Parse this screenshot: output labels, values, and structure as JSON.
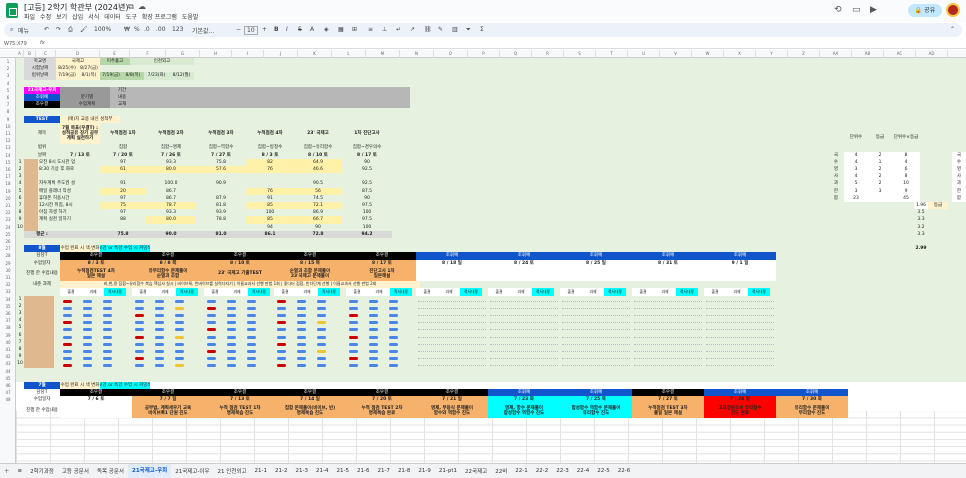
{
  "app": {
    "title": "[고등] 2학기 학관부 (2024년)",
    "share_label": "공유",
    "cell_ref": "W75:X79",
    "menu": [
      "파일",
      "수정",
      "보기",
      "삽입",
      "서식",
      "데이터",
      "도구",
      "확장 프로그램",
      "도움말"
    ],
    "toolbar": {
      "search": "메뉴",
      "zoom": "100%",
      "percent": "%",
      "dec": ".0",
      "dec2": ".00",
      "fmt": "123",
      "font": "기본값...",
      "size": "10"
    }
  },
  "columns": [
    "A",
    "B",
    "C",
    "D",
    "E",
    "F",
    "G",
    "H",
    "I",
    "J",
    "K",
    "L",
    "M",
    "N",
    "O",
    "P",
    "Q",
    "R",
    "S",
    "T",
    "U",
    "V",
    "W",
    "X",
    "Y",
    "Z",
    "AA",
    "AB",
    "AC",
    "AD",
    "AE",
    "AF",
    "AG",
    "AH",
    "AI",
    "AJ",
    "AK",
    "AL",
    "AM",
    "AN",
    "AO",
    "AP",
    "AQ"
  ],
  "rows": [
    "1",
    "2",
    "3",
    "4",
    "5",
    "6",
    "7",
    "8",
    "9",
    "10",
    "11",
    "12",
    "13",
    "14",
    "15",
    "16",
    "17",
    "18",
    "19",
    "20",
    "21",
    "22",
    "23",
    "24",
    "25",
    "26",
    "27",
    "28",
    "29",
    "30",
    "31",
    "32",
    "33",
    "34",
    "35",
    "36",
    "37",
    "38",
    "39",
    "40",
    "41",
    "42",
    "43",
    "44",
    "45",
    "46",
    "47",
    "48"
  ],
  "top": {
    "school": "학교명",
    "exam_date": "시험날짜",
    "range_date": "범위날짜",
    "s1": "국제고",
    "s2": "미추홀고",
    "s3": "인천외고",
    "d1": "8/25(수)",
    "d2": "8/27(금)",
    "r1": "7/19(금)",
    "r2": "8/1(목)",
    "r3": "7/19(금)",
    "r4": "8/8(목)",
    "r5": "7/23(화)",
    "r6": "8/12(월)"
  },
  "info": {
    "class": "21국제고-우희",
    "teacher": "조휘예",
    "label_assistant": "조우결",
    "l1": "분기별",
    "l2": "수업계획",
    "k1": "기간",
    "k2": "내용",
    "k3": "교재"
  },
  "test": {
    "header": "TEST",
    "banner": "(매)지 교용 내신 성적부",
    "subject": "제목",
    "range": "범위",
    "date": "날짜",
    "avg": "평균 :",
    "tests": [
      {
        "title": "7월 목표(우결T) : 성적공유 장기 공부 계획 실천하기",
        "range": "",
        "date": "7 / 13 토"
      },
      {
        "title": "누적점검 1차",
        "range": "집합",
        "date": "7 / 20 토"
      },
      {
        "title": "누적점검 2차",
        "range": "집합~명제",
        "date": "7 / 26 토"
      },
      {
        "title": "누적점검 3차",
        "range": "집합~역함수",
        "date": "7 / 27 토"
      },
      {
        "title": "누적점검 4차",
        "range": "집합~방정수",
        "date": "8 / 3 토"
      },
      {
        "title": "23' 국제고",
        "range": "집합~유리함수",
        "date": "8 / 10 토"
      },
      {
        "title": "1차 진단고사",
        "range": "집합~경우의수",
        "date": "8 / 17 토"
      }
    ],
    "students": [
      {
        "n": "1",
        "name": "오전 8시 도시관 업",
        "v": [
          "97",
          "93.3",
          "75.8",
          "82",
          "64.9",
          "90"
        ],
        "hl": [
          0,
          0,
          0,
          1,
          1,
          0
        ]
      },
      {
        "n": "2",
        "name": "8:30 기상 후 화로",
        "v": [
          "61",
          "80.0",
          "57.6",
          "76",
          "46.6",
          "92.5"
        ],
        "hl": [
          1,
          1,
          1,
          1,
          1,
          0
        ]
      },
      {
        "n": "3",
        "name": "",
        "v": [
          "",
          "",
          "",
          "",
          "",
          ""
        ],
        "hl": [
          0,
          0,
          0,
          0,
          0,
          0
        ]
      },
      {
        "n": "4",
        "name": "자투계획 주도권 설",
        "v": [
          "91",
          "100.0",
          "90.9",
          "",
          "90.5",
          "92.5"
        ],
        "hl": [
          0,
          0,
          0,
          0,
          0,
          0
        ]
      },
      {
        "n": "5",
        "name": "매일 플래너 작성",
        "v": [
          "20",
          "86.7",
          "",
          "76",
          "56",
          "87.5"
        ],
        "hl": [
          1,
          0,
          0,
          1,
          1,
          0
        ]
      },
      {
        "n": "6",
        "name": "휴대폰 허용시간",
        "v": [
          "97",
          "86.7",
          "87.9",
          "91",
          "74.5",
          "90"
        ],
        "hl": [
          0,
          0,
          0,
          0,
          0,
          0
        ]
      },
      {
        "n": "7",
        "name": "12시전 취침, 8시",
        "v": [
          "75",
          "78.7",
          "81.8",
          "85",
          "72.1",
          "97.5"
        ],
        "hl": [
          1,
          1,
          0,
          1,
          1,
          0
        ]
      },
      {
        "n": "8",
        "name": "아침 자생 하기",
        "v": [
          "97",
          "93.3",
          "93.9",
          "100",
          "86.9",
          "100"
        ],
        "hl": [
          0,
          0,
          0,
          0,
          0,
          0
        ]
      },
      {
        "n": "9",
        "name": "계획 실천 일하기",
        "v": [
          "88",
          "80.0",
          "78.8",
          "85",
          "66.7",
          "97.5"
        ],
        "hl": [
          0,
          1,
          0,
          1,
          1,
          0
        ]
      },
      {
        "n": "10",
        "name": "",
        "v": [
          "",
          "",
          "",
          "94",
          "90",
          "100"
        ],
        "hl": [
          0,
          0,
          0,
          0,
          0,
          0
        ]
      }
    ],
    "averages": [
      "75.8",
      "90.0",
      "81.0",
      "86.1",
      "72.8",
      "94.2"
    ]
  },
  "rank": {
    "h1": "단위수",
    "h2": "등급",
    "h3": "단위수×등급",
    "rows": [
      [
        "국",
        "4",
        "2",
        "8"
      ],
      [
        "수",
        "4",
        "1",
        "4"
      ],
      [
        "영",
        "3",
        "2",
        "6"
      ],
      [
        "사",
        "4",
        "2",
        "8"
      ],
      [
        "과",
        "5",
        "2",
        "10"
      ],
      [
        "한",
        "3",
        "3",
        "9"
      ],
      [
        "합",
        "23",
        "",
        "45"
      ]
    ],
    "total": "1.96",
    "grade_label": "등급",
    "tail": [
      "3.5",
      "3.3",
      "3.2",
      "3.3"
    ],
    "final": "2.99",
    "right_col": [
      "국",
      "수",
      "영",
      "사",
      "과",
      "한",
      "합"
    ]
  },
  "aug": {
    "month": "8월",
    "banner1": "수업 완료 시 색 변화",
    "banner2": "보강 or 특강 수업 시 커밍색",
    "labels": {
      "teacher": "담당T",
      "date": "수업일자",
      "progress": "진행 한 수업내용",
      "homework": "내준 과제"
    },
    "weeks": [
      {
        "t": "조우결",
        "d": "8 / 3 토",
        "p": "누적점검TEST 4차\n일본 해설"
      },
      {
        "t": "조우결",
        "d": "8 / 8 목",
        "p": "유무리함수 문제풀이\n순열과 조합"
      },
      {
        "t": "조우결",
        "d": "8 / 10 토",
        "p": "23' 국제고 기출TEST"
      },
      {
        "t": "조우결",
        "d": "8 / 15 목",
        "p": "순열과 조합 문제풀이\n23'국제고 문제풀이"
      },
      {
        "t": "조우결",
        "d": "8 / 17 토",
        "p": "진단고사 1차\n일본해설"
      },
      {
        "t": "조휘예",
        "d": "8 / 18 일",
        "p": ""
      },
      {
        "t": "조휘예",
        "d": "8 / 24 토",
        "p": ""
      },
      {
        "t": "조휘예",
        "d": "8 / 25 일",
        "p": ""
      },
      {
        "t": "조휘예",
        "d": "8 / 31 토",
        "p": ""
      },
      {
        "t": "조휘예",
        "d": "9 / 1 일",
        "p": ""
      }
    ],
    "homework_text": "비,변,용 집합~유리함수 복습 핵심사 실시 | 비이브룩, 빈버이브를 실력다지기 | 이름교과서 선행 판법 1회 | 좋다터 집합, 빈다단계 선행 | 이름교과서 선행 판법 2회",
    "check_labels": [
      "출결",
      "과제",
      "적서내용"
    ]
  },
  "jul": {
    "month": "7월",
    "banner1": "수업 완료 시 색 변화",
    "banner2": "보강 or 특강 수업 시 커밍색",
    "labels": {
      "teacher": "담당T",
      "date": "수업일자",
      "progress": "진행 한 수업내용"
    },
    "weeks": [
      {
        "t": "조우결",
        "d": "7 / 6 토",
        "p": ""
      },
      {
        "t": "조우결",
        "d": "7 / 7 일",
        "p": "공부법, 계획세우기 교육\n비이브룩1 단원 진도"
      },
      {
        "t": "조우결",
        "d": "7 / 13 토",
        "p": "누적 점검 TEST 1차\n명제복습 진도"
      },
      {
        "t": "조우결",
        "d": "7 / 14 일",
        "p": "집합 문제풀이(비이브, 빈)\n명제복습 진도"
      },
      {
        "t": "조우결",
        "d": "7 / 20 토",
        "p": "누적 점검 TEST 2차\n명제복습 완료"
      },
      {
        "t": "조우결",
        "d": "7 / 21 일",
        "p": "명제, 부등식 문제풀이\n함수와 역함수 진도"
      },
      {
        "t": "조휘예",
        "d": "7 / 23 화",
        "p": "명제, 함수 문제풀이\n합성함수 역함수 진도"
      },
      {
        "t": "조휘예",
        "d": "7 / 25 목",
        "p": "합성함수 역함수 문제풀이\n유리함수 진도"
      },
      {
        "t": "조우결",
        "d": "7 / 27 토",
        "p": "누적점검 TEST 3차\n풀일 일본 해설"
      },
      {
        "t": "조휘예",
        "d": "7 / 28 일",
        "p": "고유정원조보 유리함수\n진도 완료"
      },
      {
        "t": "조휘예",
        "d": "7 / 30 화",
        "p": "유리함수 문제풀이\n무리함수 진도"
      }
    ]
  },
  "tabs": [
    "2학기과정",
    "고등 공문서",
    "독목 공문서",
    "21국제고-우희",
    "21국제고-이우",
    "21 인천외고",
    "21-1",
    "21-2",
    "21-3",
    "21-4",
    "21-5",
    "21-6",
    "21-7",
    "21-8",
    "21-9",
    "21-pt1",
    "22국제고",
    "22비",
    "22-1",
    "22-2",
    "22-3",
    "22-4",
    "22-5",
    "22-6"
  ],
  "active_tab": "21국제고-우희",
  "colors": {
    "green": "#d9ead3",
    "yellow": "#fff2cc",
    "gold": "#f6b26b",
    "cyan": "#00ffff",
    "red": "#ff0000",
    "blue": "#1155cc",
    "black": "#000000",
    "magenta": "#ff00ff",
    "gray": "#cccccc"
  }
}
